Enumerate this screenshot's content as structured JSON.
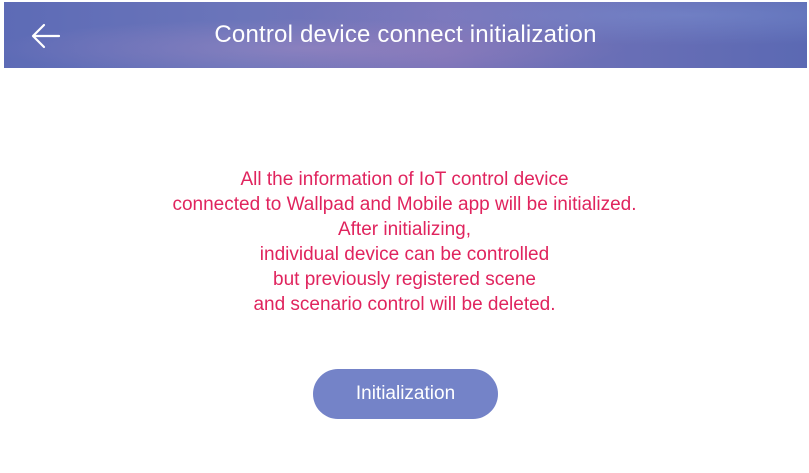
{
  "header": {
    "title": "Control device connect initialization",
    "back_icon": "arrow-left-icon"
  },
  "message": {
    "lines": [
      "All the information of IoT control device",
      "connected to Wallpad and Mobile app will be initialized.",
      "After initializing,",
      "individual device can be controlled",
      "but previously registered scene",
      "and scenario control will be deleted."
    ],
    "color": "#e0245e"
  },
  "actions": {
    "initialize_label": "Initialization",
    "button_color": "#7483c8"
  }
}
